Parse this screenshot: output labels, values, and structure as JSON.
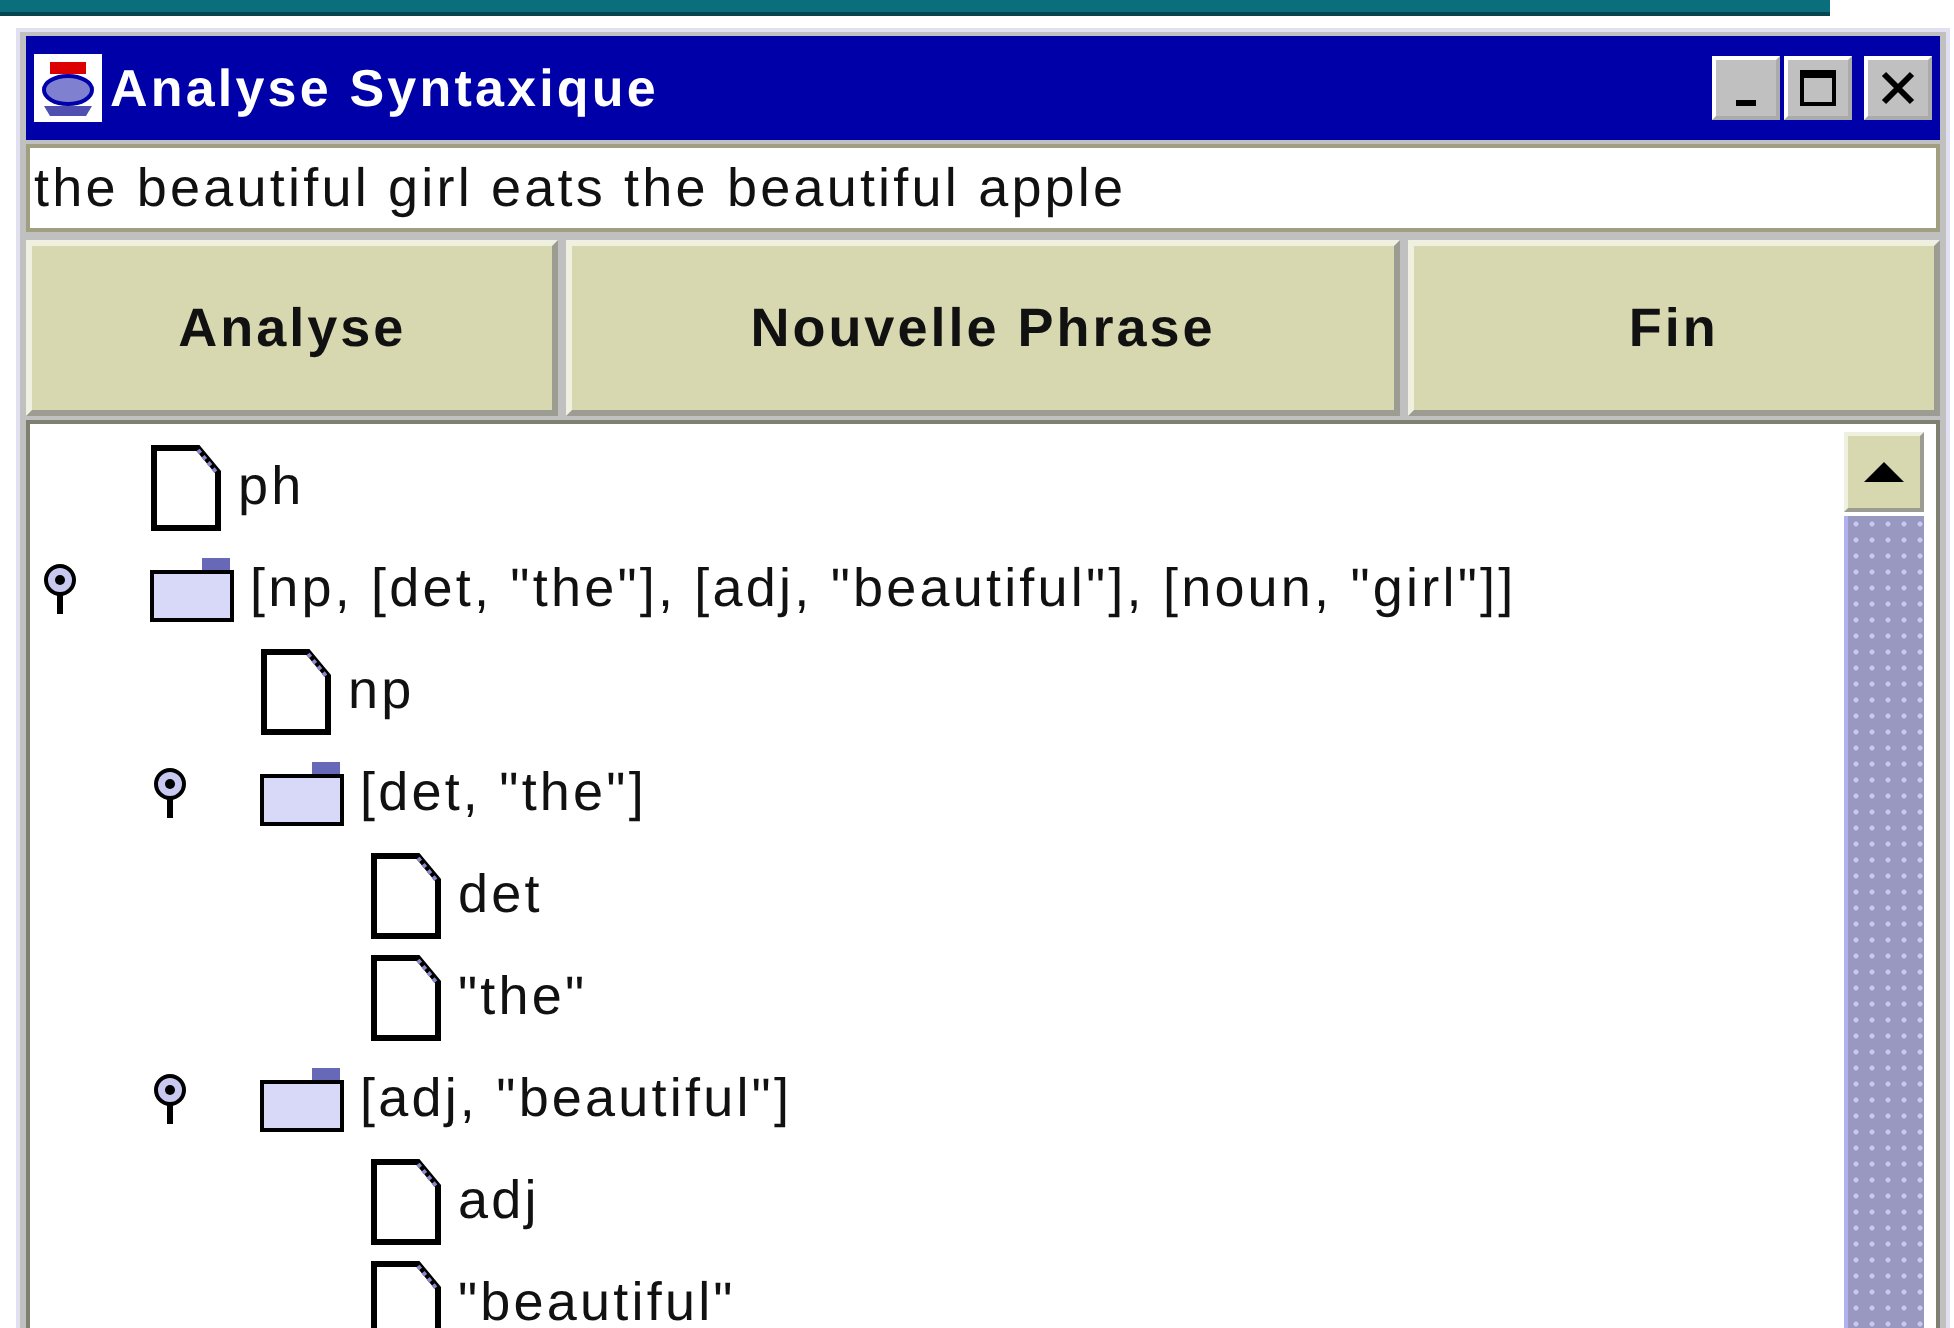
{
  "window": {
    "title": "Analyse Syntaxique"
  },
  "sentence_field": {
    "value": "the beautiful girl eats the beautiful apple"
  },
  "buttons": [
    "Analyse",
    "Nouvelle Phrase",
    "Fin"
  ],
  "tree": [
    {
      "label": "ph",
      "kind": "leaf"
    },
    {
      "label": "[np, [det, \"the\"], [adj, \"beautiful\"], [noun, \"girl\"]]",
      "kind": "folder",
      "expanded": true,
      "children": [
        {
          "label": "np",
          "kind": "leaf"
        },
        {
          "label": "[det, \"the\"]",
          "kind": "folder",
          "expanded": true,
          "children": [
            {
              "label": "det",
              "kind": "leaf"
            },
            {
              "label": "\"the\"",
              "kind": "leaf"
            }
          ]
        },
        {
          "label": "[adj, \"beautiful\"]",
          "kind": "folder",
          "expanded": true,
          "children": [
            {
              "label": "adj",
              "kind": "leaf"
            },
            {
              "label": "\"beautiful\"",
              "kind": "leaf"
            }
          ]
        }
      ]
    }
  ]
}
